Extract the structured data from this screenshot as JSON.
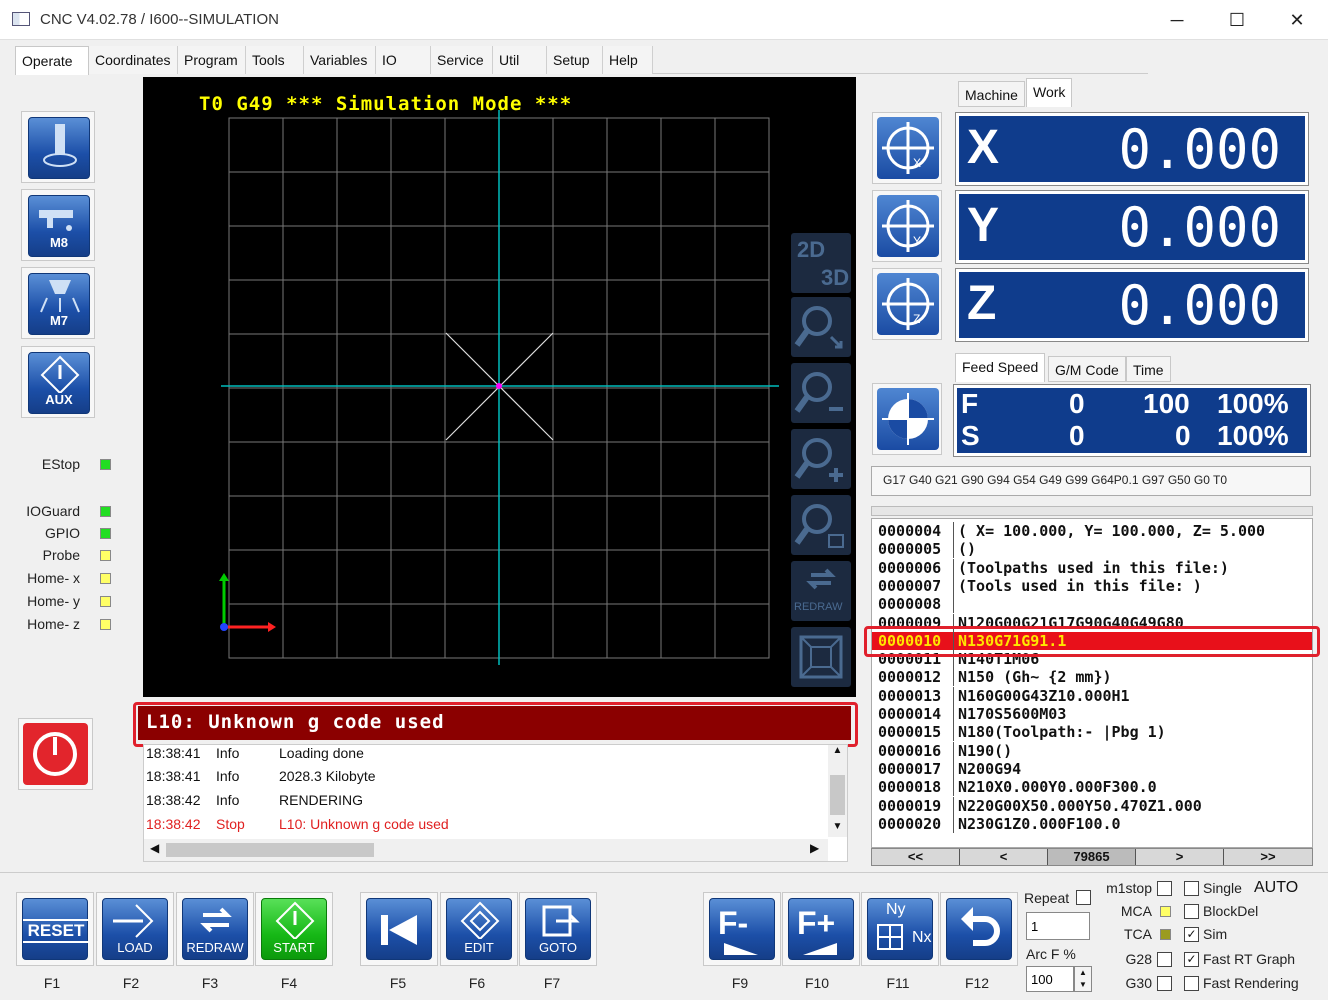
{
  "window": {
    "title": "CNC V4.02.78 / I600--SIMULATION",
    "minimize": "─",
    "maximize": "☐",
    "close": "✕"
  },
  "menu": [
    "Operate",
    "Coordinates",
    "Program",
    "Tools",
    "Variables",
    "IO",
    "Service",
    "Util",
    "Setup",
    "Help"
  ],
  "side_buttons": [
    {
      "label": "",
      "icon": "spindle-icon"
    },
    {
      "label": "M8",
      "icon": "coolant-icon"
    },
    {
      "label": "M7",
      "icon": "mist-icon"
    },
    {
      "label": "AUX",
      "icon": "aux-icon"
    }
  ],
  "status": [
    {
      "label": "EStop",
      "color": "green"
    },
    {
      "label": "IOGuard",
      "color": "green"
    },
    {
      "label": "GPIO",
      "color": "green"
    },
    {
      "label": "Probe",
      "color": "yellow"
    },
    {
      "label": "Home- x",
      "color": "yellow"
    },
    {
      "label": "Home- y",
      "color": "yellow"
    },
    {
      "label": "Home- z",
      "color": "yellow"
    }
  ],
  "sim": {
    "title": "T0 G49 *** Simulation Mode ***",
    "tools": [
      "2D/3D",
      "zoom-fit",
      "zoom-out",
      "zoom-in",
      "zoom-window",
      "REDRAW",
      "view-box"
    ],
    "tool_2d": "2D",
    "tool_3d": "3D",
    "tool_redraw": "REDRAW"
  },
  "error": "L10: Unknown g code used",
  "log": [
    {
      "time": "18:38:41",
      "type": "Info",
      "msg": "Loading done",
      "error": false
    },
    {
      "time": "18:38:41",
      "type": "Info",
      "msg": "2028.3 Kilobyte",
      "error": false
    },
    {
      "time": "18:38:42",
      "type": "Info",
      "msg": "RENDERING",
      "error": false
    },
    {
      "time": "18:38:42",
      "type": "Stop",
      "msg": "L10: Unknown g code used",
      "error": true
    }
  ],
  "coord_tabs": [
    "Machine",
    "Work"
  ],
  "axes": [
    {
      "name": "X",
      "value": "0.000"
    },
    {
      "name": "Y",
      "value": "0.000"
    },
    {
      "name": "Z",
      "value": "0.000"
    }
  ],
  "info_tabs": [
    "Feed Speed",
    "G/M Code",
    "Time"
  ],
  "feed": {
    "f_label": "F",
    "f_value": "0",
    "f_set": "100",
    "f_pct": "100%",
    "s_label": "S",
    "s_value": "0",
    "s_set": "0",
    "s_pct": "100%"
  },
  "gcodes": "G17 G40 G21 G90 G94 G54 G49 G99 G64P0.1 G97 G50 G0 T0",
  "code_lines": [
    {
      "n": "0000004",
      "t": "( X= 100.000, Y= 100.000, Z= 5.000"
    },
    {
      "n": "0000005",
      "t": "()"
    },
    {
      "n": "0000006",
      "t": "(Toolpaths used in this file:)"
    },
    {
      "n": "0000007",
      "t": "(Tools used in this file: )"
    },
    {
      "n": "0000008",
      "t": ""
    },
    {
      "n": "0000009",
      "t": "N120G00G21G17G90G40G49G80"
    },
    {
      "n": "0000010",
      "t": "N130G71G91.1"
    },
    {
      "n": "0000011",
      "t": "N140T1M06"
    },
    {
      "n": "0000012",
      "t": "N150 (Gh~ {2 mm})"
    },
    {
      "n": "0000013",
      "t": "N160G00G43Z10.000H1"
    },
    {
      "n": "0000014",
      "t": "N170S5600M03"
    },
    {
      "n": "0000015",
      "t": "N180(Toolpath:-  |Pbg 1)"
    },
    {
      "n": "0000016",
      "t": "N190()"
    },
    {
      "n": "0000017",
      "t": "N200G94"
    },
    {
      "n": "0000018",
      "t": "N210X0.000Y0.000F300.0"
    },
    {
      "n": "0000019",
      "t": "N220G00X50.000Y50.470Z1.000"
    },
    {
      "n": "0000020",
      "t": "N230G1Z0.000F100.0"
    }
  ],
  "nav": {
    "first": "<<",
    "prev": "<",
    "line": "79865",
    "next": ">",
    "last": ">>"
  },
  "bottom": [
    {
      "label": "RESET",
      "key": "F1"
    },
    {
      "label": "LOAD",
      "key": "F2"
    },
    {
      "label": "REDRAW",
      "key": "F3"
    },
    {
      "label": "START",
      "key": "F4"
    },
    {
      "label": "",
      "key": "F5"
    },
    {
      "label": "EDIT",
      "key": "F6"
    },
    {
      "label": "GOTO",
      "key": "F7"
    },
    {
      "label": "F-",
      "key": "F9"
    },
    {
      "label": "F+",
      "key": "F10"
    },
    {
      "label": "Nx",
      "key": "F11"
    },
    {
      "label": "",
      "key": "F12"
    }
  ],
  "nynx": {
    "ny": "Ny",
    "nx": "Nx"
  },
  "repeat": {
    "label": "Repeat",
    "value": "1"
  },
  "arcf": {
    "label": "Arc F %",
    "value": "100"
  },
  "options": {
    "m1stop": "m1stop",
    "mca": "MCA",
    "tca": "TCA",
    "g28": "G28",
    "g30": "G30",
    "single": "Single",
    "auto": "AUTO",
    "blockdel": "BlockDel",
    "sim": "Sim",
    "fastrt": "Fast RT Graph",
    "fastrender": "Fast Rendering"
  }
}
